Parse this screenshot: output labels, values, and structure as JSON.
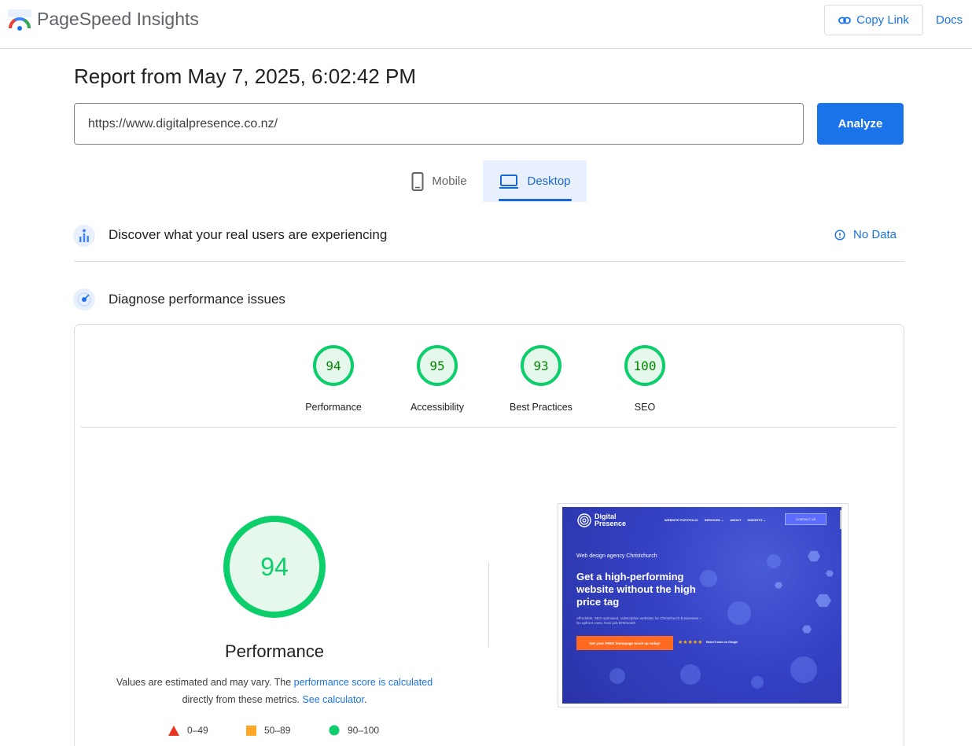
{
  "header": {
    "brand": "PageSpeed Insights",
    "copy_link_label": "Copy Link",
    "docs_label": "Docs"
  },
  "report": {
    "title": "Report from May 7, 2025, 6:02:42 PM",
    "url_value": "https://www.digitalpresence.co.nz/",
    "analyze_label": "Analyze"
  },
  "tabs": [
    {
      "label": "Mobile",
      "selected": false
    },
    {
      "label": "Desktop",
      "selected": true
    }
  ],
  "real_users": {
    "title": "Discover what your real users are experiencing",
    "no_data_label": "No Data"
  },
  "diagnose": {
    "title": "Diagnose performance issues"
  },
  "scores": [
    {
      "value": "94",
      "label": "Performance"
    },
    {
      "value": "95",
      "label": "Accessibility"
    },
    {
      "value": "93",
      "label": "Best Practices"
    },
    {
      "value": "100",
      "label": "SEO"
    }
  ],
  "performance": {
    "score": "94",
    "label": "Performance",
    "note_pre": "Values are estimated and may vary. The ",
    "note_link1": "performance score is calculated",
    "note_mid": " directly from these metrics. ",
    "note_link2": "See calculator",
    "note_end": "."
  },
  "legend": [
    {
      "range": "0–49",
      "shape": "triangle",
      "color": "#ea3323"
    },
    {
      "range": "50–89",
      "shape": "square",
      "color": "#ffa726"
    },
    {
      "range": "90–100",
      "shape": "circle",
      "color": "#0cce6b"
    }
  ],
  "thumbnail": {
    "logo_line1": "Digital",
    "logo_line2": "Presence",
    "nav": [
      "WEBSITE PORTFOLIO",
      "SERVICES ⌄",
      "ABOUT",
      "INSIGHTS ⌄"
    ],
    "contact": "CONTACT US",
    "subtitle": "Web design agency Christchurch",
    "headline": "Get a high-performing website without the high price tag",
    "paragraph": "Affordable, SEO-optimised, subscription websites for Christchurch businesses – No upfront costs, from just $70/month",
    "cta": "Get your FREE homepage mock up today!",
    "stars": "★★★★★",
    "rated": "Rated 5 stars on Google"
  },
  "colors": {
    "accent": "#1a73e8",
    "pass": "#0cce6b",
    "pass_text": "#008800",
    "pass_fill": "#e6f7ec"
  }
}
